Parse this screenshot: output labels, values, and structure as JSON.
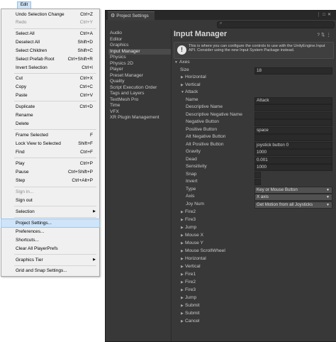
{
  "menubar": {
    "edit_label": "Edit"
  },
  "edit_menu": {
    "items": [
      {
        "label": "Undo Selection Change",
        "shortcut": "Ctrl+Z"
      },
      {
        "label": "Redo",
        "shortcut": "Ctrl+Y"
      },
      {
        "label": "Select All",
        "shortcut": "Ctrl+A"
      },
      {
        "label": "Deselect All",
        "shortcut": "Shift+D"
      },
      {
        "label": "Select Children",
        "shortcut": "Shift+C"
      },
      {
        "label": "Select Prefab Root",
        "shortcut": "Ctrl+Shift+R"
      },
      {
        "label": "Invert Selection",
        "shortcut": "Ctrl+I"
      },
      {
        "label": "Cut",
        "shortcut": "Ctrl+X"
      },
      {
        "label": "Copy",
        "shortcut": "Ctrl+C"
      },
      {
        "label": "Paste",
        "shortcut": "Ctrl+V"
      },
      {
        "label": "Duplicate",
        "shortcut": "Ctrl+D"
      },
      {
        "label": "Rename",
        "shortcut": ""
      },
      {
        "label": "Delete",
        "shortcut": ""
      },
      {
        "label": "Frame Selected",
        "shortcut": "F"
      },
      {
        "label": "Lock View to Selected",
        "shortcut": "Shift+F"
      },
      {
        "label": "Find",
        "shortcut": "Ctrl+F"
      },
      {
        "label": "Play",
        "shortcut": "Ctrl+P"
      },
      {
        "label": "Pause",
        "shortcut": "Ctrl+Shift+P"
      },
      {
        "label": "Step",
        "shortcut": "Ctrl+Alt+P"
      },
      {
        "label": "Sign in...",
        "shortcut": ""
      },
      {
        "label": "Sign out",
        "shortcut": ""
      },
      {
        "label": "Selection",
        "shortcut": ""
      },
      {
        "label": "Project Settings...",
        "shortcut": ""
      },
      {
        "label": "Preferences...",
        "shortcut": ""
      },
      {
        "label": "Shortcuts...",
        "shortcut": ""
      },
      {
        "label": "Clear All PlayerPrefs",
        "shortcut": ""
      },
      {
        "label": "Graphics Tier",
        "shortcut": ""
      },
      {
        "label": "Grid and Snap Settings...",
        "shortcut": ""
      }
    ]
  },
  "window": {
    "tab_title": "Project Settings"
  },
  "sidebar": {
    "items": [
      "Audio",
      "Editor",
      "Graphics",
      "Input Manager",
      "Physics",
      "Physics 2D",
      "Player",
      "Preset Manager",
      "Quality",
      "Script Execution Order",
      "Tags and Layers",
      "TextMesh Pro",
      "Time",
      "VFX",
      "XR Plugin Management"
    ],
    "selected": "Input Manager"
  },
  "content": {
    "title": "Input Manager",
    "info": "This is where you can configure the controls to use with the UnityEngine.Input API. Consider using the new Input System Package instead.",
    "axes_label": "Axes",
    "size_label": "Size",
    "size_value": "18",
    "horizontal": "Horizontal",
    "vertical": "Vertical",
    "attack": "Attack",
    "props": {
      "name": {
        "label": "Name",
        "value": "Attack"
      },
      "desc": {
        "label": "Descriptive Name",
        "value": ""
      },
      "desc_neg": {
        "label": "Descriptive Negative Name",
        "value": ""
      },
      "neg_btn": {
        "label": "Negative Button",
        "value": ""
      },
      "pos_btn": {
        "label": "Positive Button",
        "value": "space"
      },
      "alt_neg": {
        "label": "Alt Negative Button",
        "value": ""
      },
      "alt_pos": {
        "label": "Alt Positive Button",
        "value": "joystick button 0"
      },
      "gravity": {
        "label": "Gravity",
        "value": "1000"
      },
      "dead": {
        "label": "Dead",
        "value": "0.001"
      },
      "sensitivity": {
        "label": "Sensitivity",
        "value": "1000"
      },
      "snap": {
        "label": "Snap"
      },
      "invert": {
        "label": "Invert"
      },
      "type": {
        "label": "Type",
        "value": "Key or Mouse Button"
      },
      "axis": {
        "label": "Axis",
        "value": "X axis"
      },
      "joy": {
        "label": "Joy Num",
        "value": "Get Motion from all Joysticks"
      }
    },
    "other_axes": [
      "Fire2",
      "Fire3",
      "Jump",
      "Mouse X",
      "Mouse Y",
      "Mouse ScrollWheel",
      "Horizontal",
      "Vertical",
      "Fire1",
      "Fire2",
      "Fire3",
      "Jump",
      "Submit",
      "Submit",
      "Cancel"
    ]
  }
}
